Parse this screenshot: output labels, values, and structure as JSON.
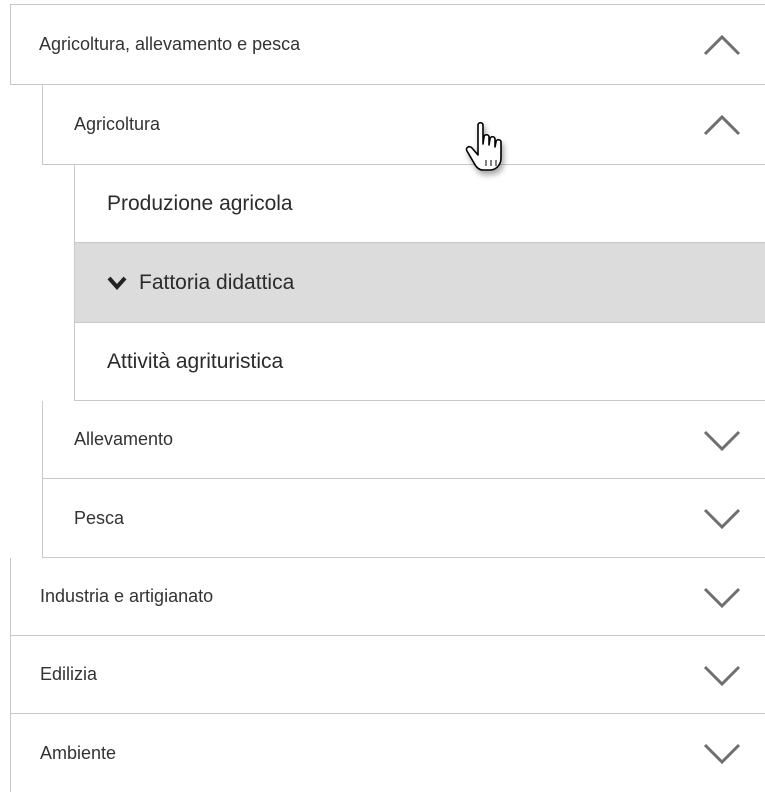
{
  "accordion": {
    "section_agricoltura": {
      "label": "Agricoltura, allevamento e pesca",
      "icon": "chevron-up-icon",
      "expanded": true,
      "children": {
        "agricoltura": {
          "label": "Agricoltura",
          "icon": "chevron-up-icon",
          "expanded": true,
          "items": [
            {
              "label": "Produzione agricola"
            },
            {
              "label": "Fattoria didattica",
              "icon": "chevron-down-solid-icon",
              "selected": true
            },
            {
              "label": "Attività agrituristica"
            }
          ]
        },
        "allevamento": {
          "label": "Allevamento",
          "icon": "chevron-down-icon"
        },
        "pesca": {
          "label": "Pesca",
          "icon": "chevron-down-icon"
        }
      }
    },
    "section_industria": {
      "label": "Industria e artigianato",
      "icon": "chevron-down-icon"
    },
    "section_edilizia": {
      "label": "Edilizia",
      "icon": "chevron-down-icon"
    },
    "section_ambiente": {
      "label": "Ambiente",
      "icon": "chevron-down-icon"
    }
  },
  "colors": {
    "border": "#c9c9c9",
    "selected_background": "#dcdcdc",
    "chevron": "#6f6f6f",
    "text": "#333333"
  },
  "cursor": {
    "icon": "hand-pointer-cursor"
  }
}
